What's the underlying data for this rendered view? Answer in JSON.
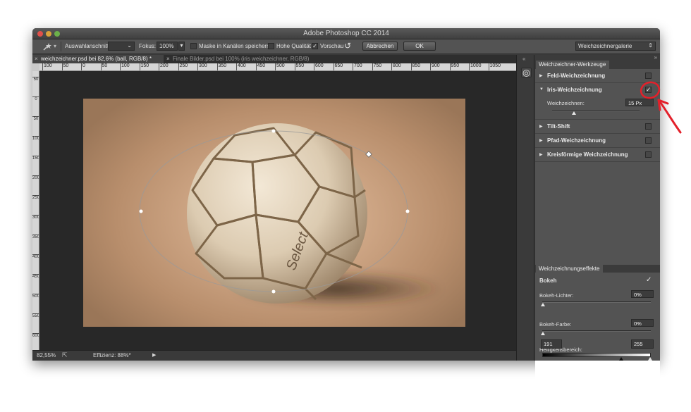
{
  "window": {
    "title": "Adobe Photoshop CC 2014"
  },
  "options_bar": {
    "view_label": "Auswahlanschnitt:",
    "focus_label": "Fokus:",
    "focus_value": "100%",
    "mask_label": "Maske in Kanälen speichern",
    "quality_label": "Hohe Qualität",
    "preview_label": "Vorschau",
    "cancel_label": "Abbrechen",
    "ok_label": "OK",
    "gallery_select": "Weichzeichnergalerie"
  },
  "tabs": [
    {
      "label": "weichzeichner.psd bei 82,6% (ball, RGB/8) *"
    },
    {
      "label": "Finale Bilder.psd bei 100% (iris weichzeichner, RGB/8)"
    }
  ],
  "ruler": {
    "h_ticks": [
      "100",
      "50",
      "0",
      "50",
      "100",
      "150",
      "200",
      "250",
      "300",
      "350",
      "400",
      "450",
      "500",
      "550",
      "600",
      "650",
      "700",
      "750",
      "800",
      "850",
      "900",
      "950",
      "1000",
      "1050"
    ],
    "v_ticks": [
      "50",
      "0",
      "50",
      "100",
      "150",
      "200",
      "250",
      "300",
      "350",
      "400",
      "450",
      "500",
      "550",
      "600"
    ]
  },
  "status": {
    "zoom": "82,55%",
    "efficiency": "Effizienz: 88%*"
  },
  "blur_tools_panel": {
    "tab_label": "Weichzeichner-Werkzeuge",
    "items": [
      {
        "label": "Feld-Weichzeichnung",
        "checked": false,
        "expanded": false
      },
      {
        "label": "Iris-Weichzeichnung",
        "checked": true,
        "expanded": true
      },
      {
        "label": "Tilt-Shift",
        "checked": false,
        "expanded": false
      },
      {
        "label": "Pfad-Weichzeichnung",
        "checked": false,
        "expanded": false
      },
      {
        "label": "Kreisförmige Weichzeichnung",
        "checked": false,
        "expanded": false
      }
    ],
    "iris": {
      "blur_label": "Weichzeichnen:",
      "blur_value": "15 Px"
    }
  },
  "effects_panel": {
    "tab_label": "Weichzeichnungseffekte",
    "bokeh_label": "Bokeh",
    "bokeh_checked": true,
    "light_label": "Bokeh-Lichter:",
    "light_value": "0%",
    "color_label": "Bokeh-Farbe:",
    "color_value": "0%",
    "range_label": "Helligkeitsbereich:",
    "range_low": "191",
    "range_high": "255"
  },
  "colors": {
    "annotation": "#e3202a",
    "panel_bg": "#535353",
    "canvas_bg": "#282828"
  }
}
